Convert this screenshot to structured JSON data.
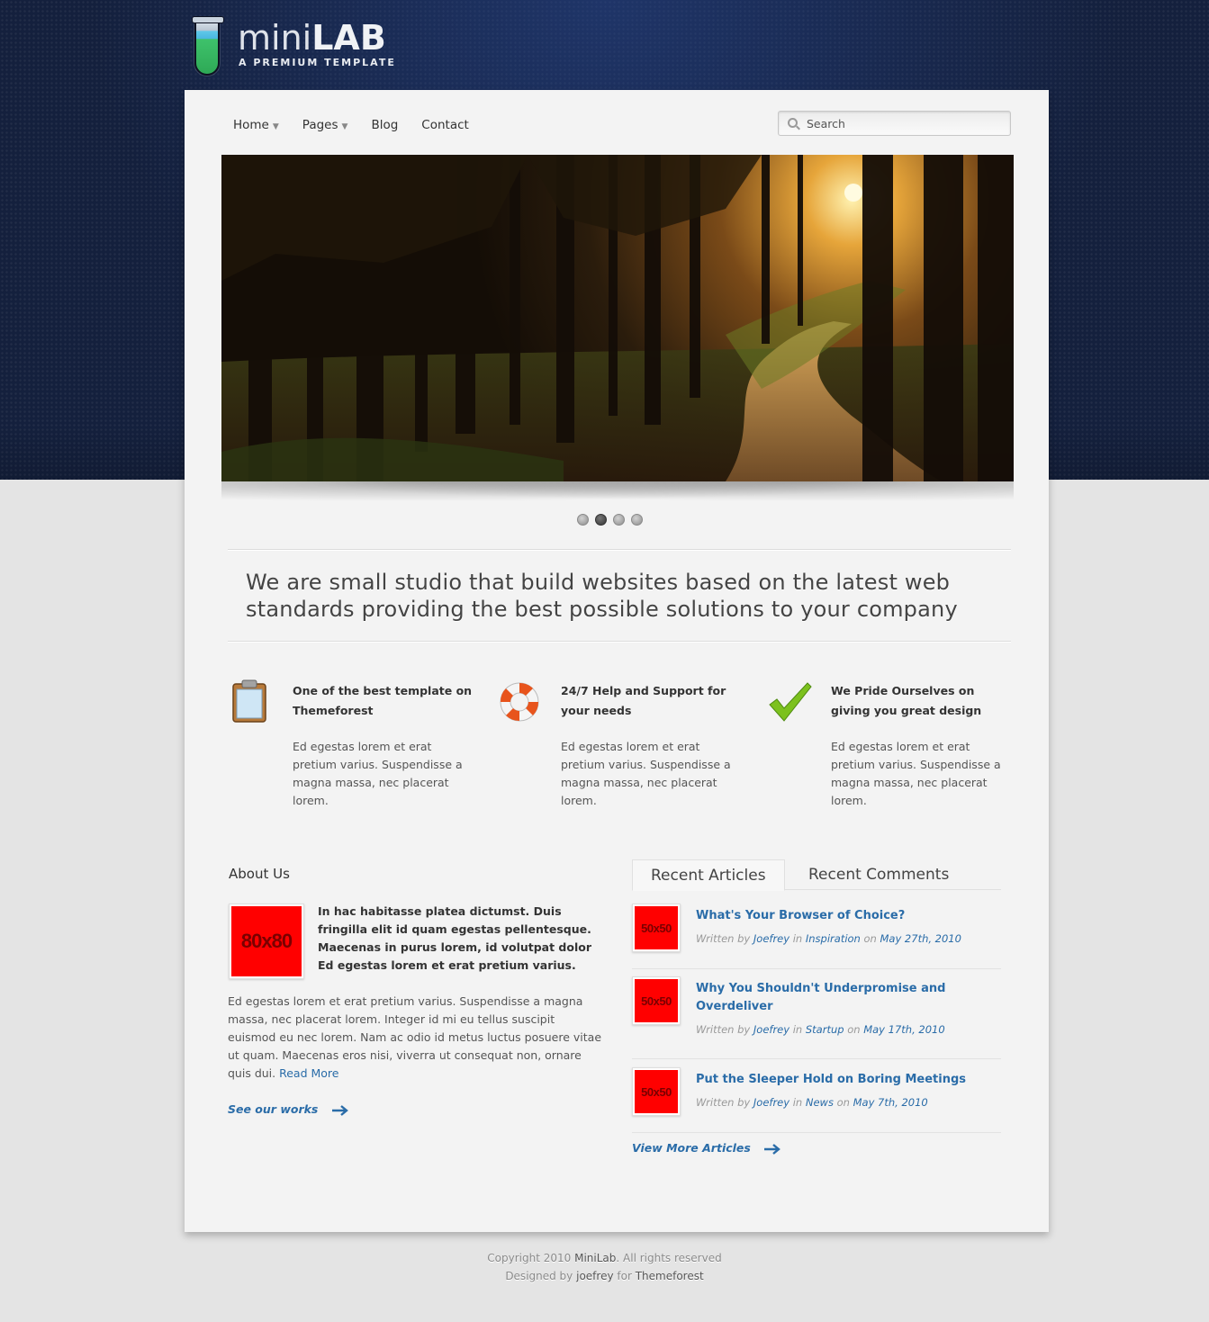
{
  "brand": {
    "name_light": "mini",
    "name_bold": "LAB",
    "tagline": "A PREMIUM TEMPLATE"
  },
  "nav": {
    "items": [
      {
        "label": "Home",
        "has_dropdown": true
      },
      {
        "label": "Pages",
        "has_dropdown": true
      },
      {
        "label": "Blog",
        "has_dropdown": false
      },
      {
        "label": "Contact",
        "has_dropdown": false
      }
    ],
    "search_placeholder": "Search"
  },
  "slider": {
    "image": "forest-path-sunset",
    "slide_count": 4,
    "active_slide": 2
  },
  "intro": {
    "text": "We are small studio that build websites based on the latest web standards providing the best possible solutions to your company"
  },
  "features": [
    {
      "icon": "clipboard-icon",
      "title": "One of the best template on Themeforest",
      "body": "Ed egestas lorem et erat pretium varius. Suspendisse a magna massa, nec placerat lorem."
    },
    {
      "icon": "lifebuoy-icon",
      "title": "24/7 Help and Support for your needs",
      "body": "Ed egestas lorem et erat pretium varius. Suspendisse a magna massa, nec placerat lorem."
    },
    {
      "icon": "checkmark-icon",
      "title": "We Pride Ourselves on giving you great design",
      "body": "Ed egestas lorem et erat pretium varius. Suspendisse a magna massa, nec placerat lorem."
    }
  ],
  "about": {
    "title": "About Us",
    "thumb_label": "80x80",
    "lead": "In hac habitasse platea dictumst. Duis fringilla elit id quam egestas pellentesque. Maecenas in purus lorem, id volutpat dolor Ed egestas lorem et erat pretium varius.",
    "body": "Ed egestas lorem et erat pretium varius. Suspendisse a magna massa, nec placerat lorem. Integer id mi eu tellus suscipit euismod eu nec lorem. Nam ac odio id metus luctus posuere vitae ut quam. Maecenas eros nisi, viverra ut consequat non, ornare quis dui.",
    "read_more": "Read More",
    "see_works": "See our works"
  },
  "tabs": {
    "items": [
      "Recent Articles",
      "Recent Comments"
    ],
    "active": 0
  },
  "articles": {
    "written_by": "Written by",
    "in_word": "in",
    "on_word": "on",
    "items": [
      {
        "thumb": "50x50",
        "title": "What's Your Browser of Choice?",
        "author": "Joefrey",
        "category": "Inspiration",
        "date": "May 27th, 2010"
      },
      {
        "thumb": "50x50",
        "title": "Why You Shouldn't Underpromise and Overdeliver",
        "author": "Joefrey",
        "category": "Startup",
        "date": "May 17th, 2010"
      },
      {
        "thumb": "50x50",
        "title": "Put the Sleeper Hold on Boring Meetings",
        "author": "Joefrey",
        "category": "News",
        "date": "May 7th, 2010"
      }
    ],
    "view_more": "View More Articles"
  },
  "footer": {
    "copyright_prefix": "Copyright 2010",
    "site": "MiniLab",
    "copyright_suffix": ". All rights reserved",
    "designed_prefix": "Designed by",
    "designer": "joefrey",
    "for_word": "for",
    "marketplace": "Themeforest"
  },
  "colors": {
    "header_bg": "#14203d",
    "link": "#2a6ca8",
    "placeholder_thumb": "#ff0000"
  }
}
